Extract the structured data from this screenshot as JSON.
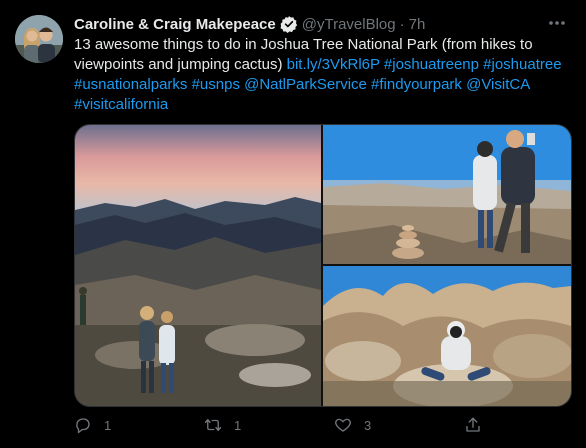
{
  "tweet": {
    "author_name": "Caroline & Craig Makepeace",
    "handle": "@yTravelBlog",
    "separator": "·",
    "time": "7h",
    "text_plain": "13 awesome things to do in Joshua Tree National Park (from hikes to viewpoints and jumping cactus)",
    "link": "bit.ly/3VkRl6P",
    "hashtags": "#joshuatreenp #joshuatree #usnationalparks #usnps @NatlParkService #findyourpark @VisitCA #visitcalifornia",
    "reply_count": "1",
    "retweet_count": "1",
    "like_count": "3"
  },
  "icons": {
    "verified": "verified-badge-icon",
    "more": "more-dots-icon",
    "reply": "reply-icon",
    "retweet": "retweet-icon",
    "like": "heart-icon",
    "share": "share-icon"
  },
  "colors": {
    "background": "#000000",
    "text": "#e7e9ea",
    "muted": "#71767b",
    "link": "#1d9bf0"
  }
}
